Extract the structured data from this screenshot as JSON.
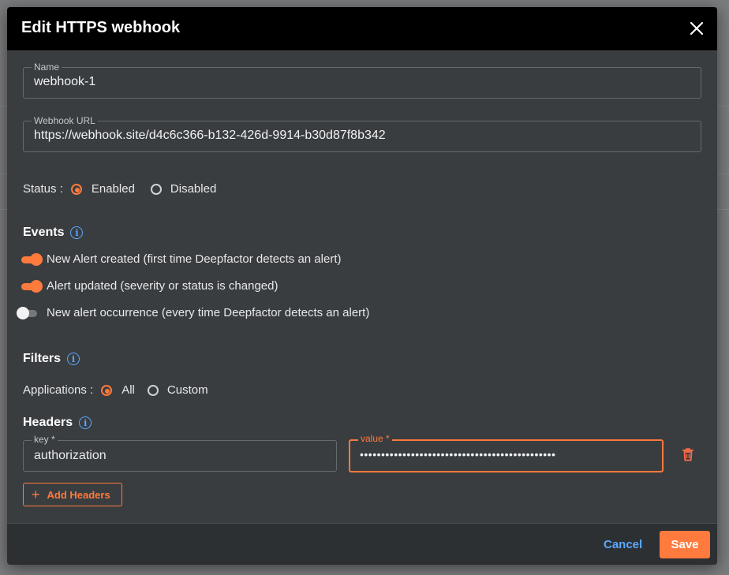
{
  "dialog": {
    "title": "Edit HTTPS webhook"
  },
  "name_field": {
    "label": "Name",
    "value": "webhook-1"
  },
  "url_field": {
    "label": "Webhook URL",
    "value": "https://webhook.site/d4c6c366-b132-426d-9914-b30d87f8b342"
  },
  "status": {
    "label": "Status :",
    "options": [
      {
        "label": "Enabled",
        "selected": true
      },
      {
        "label": "Disabled",
        "selected": false
      }
    ]
  },
  "events": {
    "title": "Events",
    "items": [
      {
        "label": "New Alert created (first time Deepfactor detects an alert)",
        "enabled": true
      },
      {
        "label": "Alert updated (severity or status is changed)",
        "enabled": true
      },
      {
        "label": "New alert occurrence (every time Deepfactor detects an alert)",
        "enabled": false
      }
    ]
  },
  "filters": {
    "title": "Filters",
    "applications_label": "Applications :",
    "options": [
      {
        "label": "All",
        "selected": true
      },
      {
        "label": "Custom",
        "selected": false
      }
    ]
  },
  "headers": {
    "title": "Headers",
    "key_label": "key *",
    "key_value": "authorization",
    "value_label": "value *",
    "value_masked": "••••••••••••••••••••••••••••••••••••••••••••••",
    "add_label": "Add Headers"
  },
  "footer": {
    "cancel_label": "Cancel",
    "save_label": "Save"
  },
  "colors": {
    "accent": "#ff7a3d",
    "link": "#5aa9ff",
    "header_bg": "#000000",
    "panel_bg": "#3a3d40"
  },
  "icons": {
    "close": "close-icon",
    "info": "info-icon",
    "trash": "trash-icon",
    "plus": "plus-icon"
  }
}
